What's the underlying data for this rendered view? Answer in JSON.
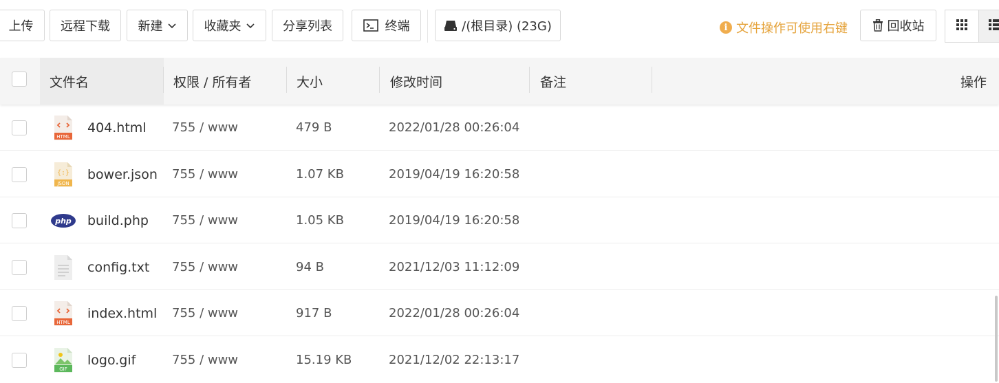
{
  "toolbar": {
    "upload": "上传",
    "remote_download": "远程下载",
    "new": "新建",
    "favorites": "收藏夹",
    "share_list": "分享列表",
    "terminal": "终端",
    "path": "/(根目录) (23G)",
    "tip": "文件操作可使用右键",
    "recycle": "回收站"
  },
  "table": {
    "headers": {
      "name": "文件名",
      "permission": "权限 / 所有者",
      "size": "大小",
      "modified": "修改时间",
      "note": "备注",
      "actions": "操作"
    },
    "rows": [
      {
        "icon": "html-file-icon",
        "name": "404.html",
        "perm": "755 / www",
        "size": "479 B",
        "mtime": "2022/01/28 00:26:04"
      },
      {
        "icon": "json-file-icon",
        "name": "bower.json",
        "perm": "755 / www",
        "size": "1.07 KB",
        "mtime": "2019/04/19 16:20:58"
      },
      {
        "icon": "php-file-icon",
        "name": "build.php",
        "perm": "755 / www",
        "size": "1.05 KB",
        "mtime": "2019/04/19 16:20:58"
      },
      {
        "icon": "txt-file-icon",
        "name": "config.txt",
        "perm": "755 / www",
        "size": "94 B",
        "mtime": "2021/12/03 11:12:09"
      },
      {
        "icon": "html-file-icon",
        "name": "index.html",
        "perm": "755 / www",
        "size": "917 B",
        "mtime": "2022/01/28 00:26:04"
      },
      {
        "icon": "gif-file-icon",
        "name": "logo.gif",
        "perm": "755 / www",
        "size": "15.19 KB",
        "mtime": "2021/12/02 22:13:17"
      }
    ]
  },
  "icon_labels": {
    "html": "HTML",
    "json": "JSON",
    "php": "php",
    "gif": "GIF"
  },
  "colors": {
    "tip": "#e5a33b",
    "html": "#e8673a",
    "json": "#f0b64d",
    "php": "#2f3a8c",
    "gif": "#5cb85c"
  }
}
